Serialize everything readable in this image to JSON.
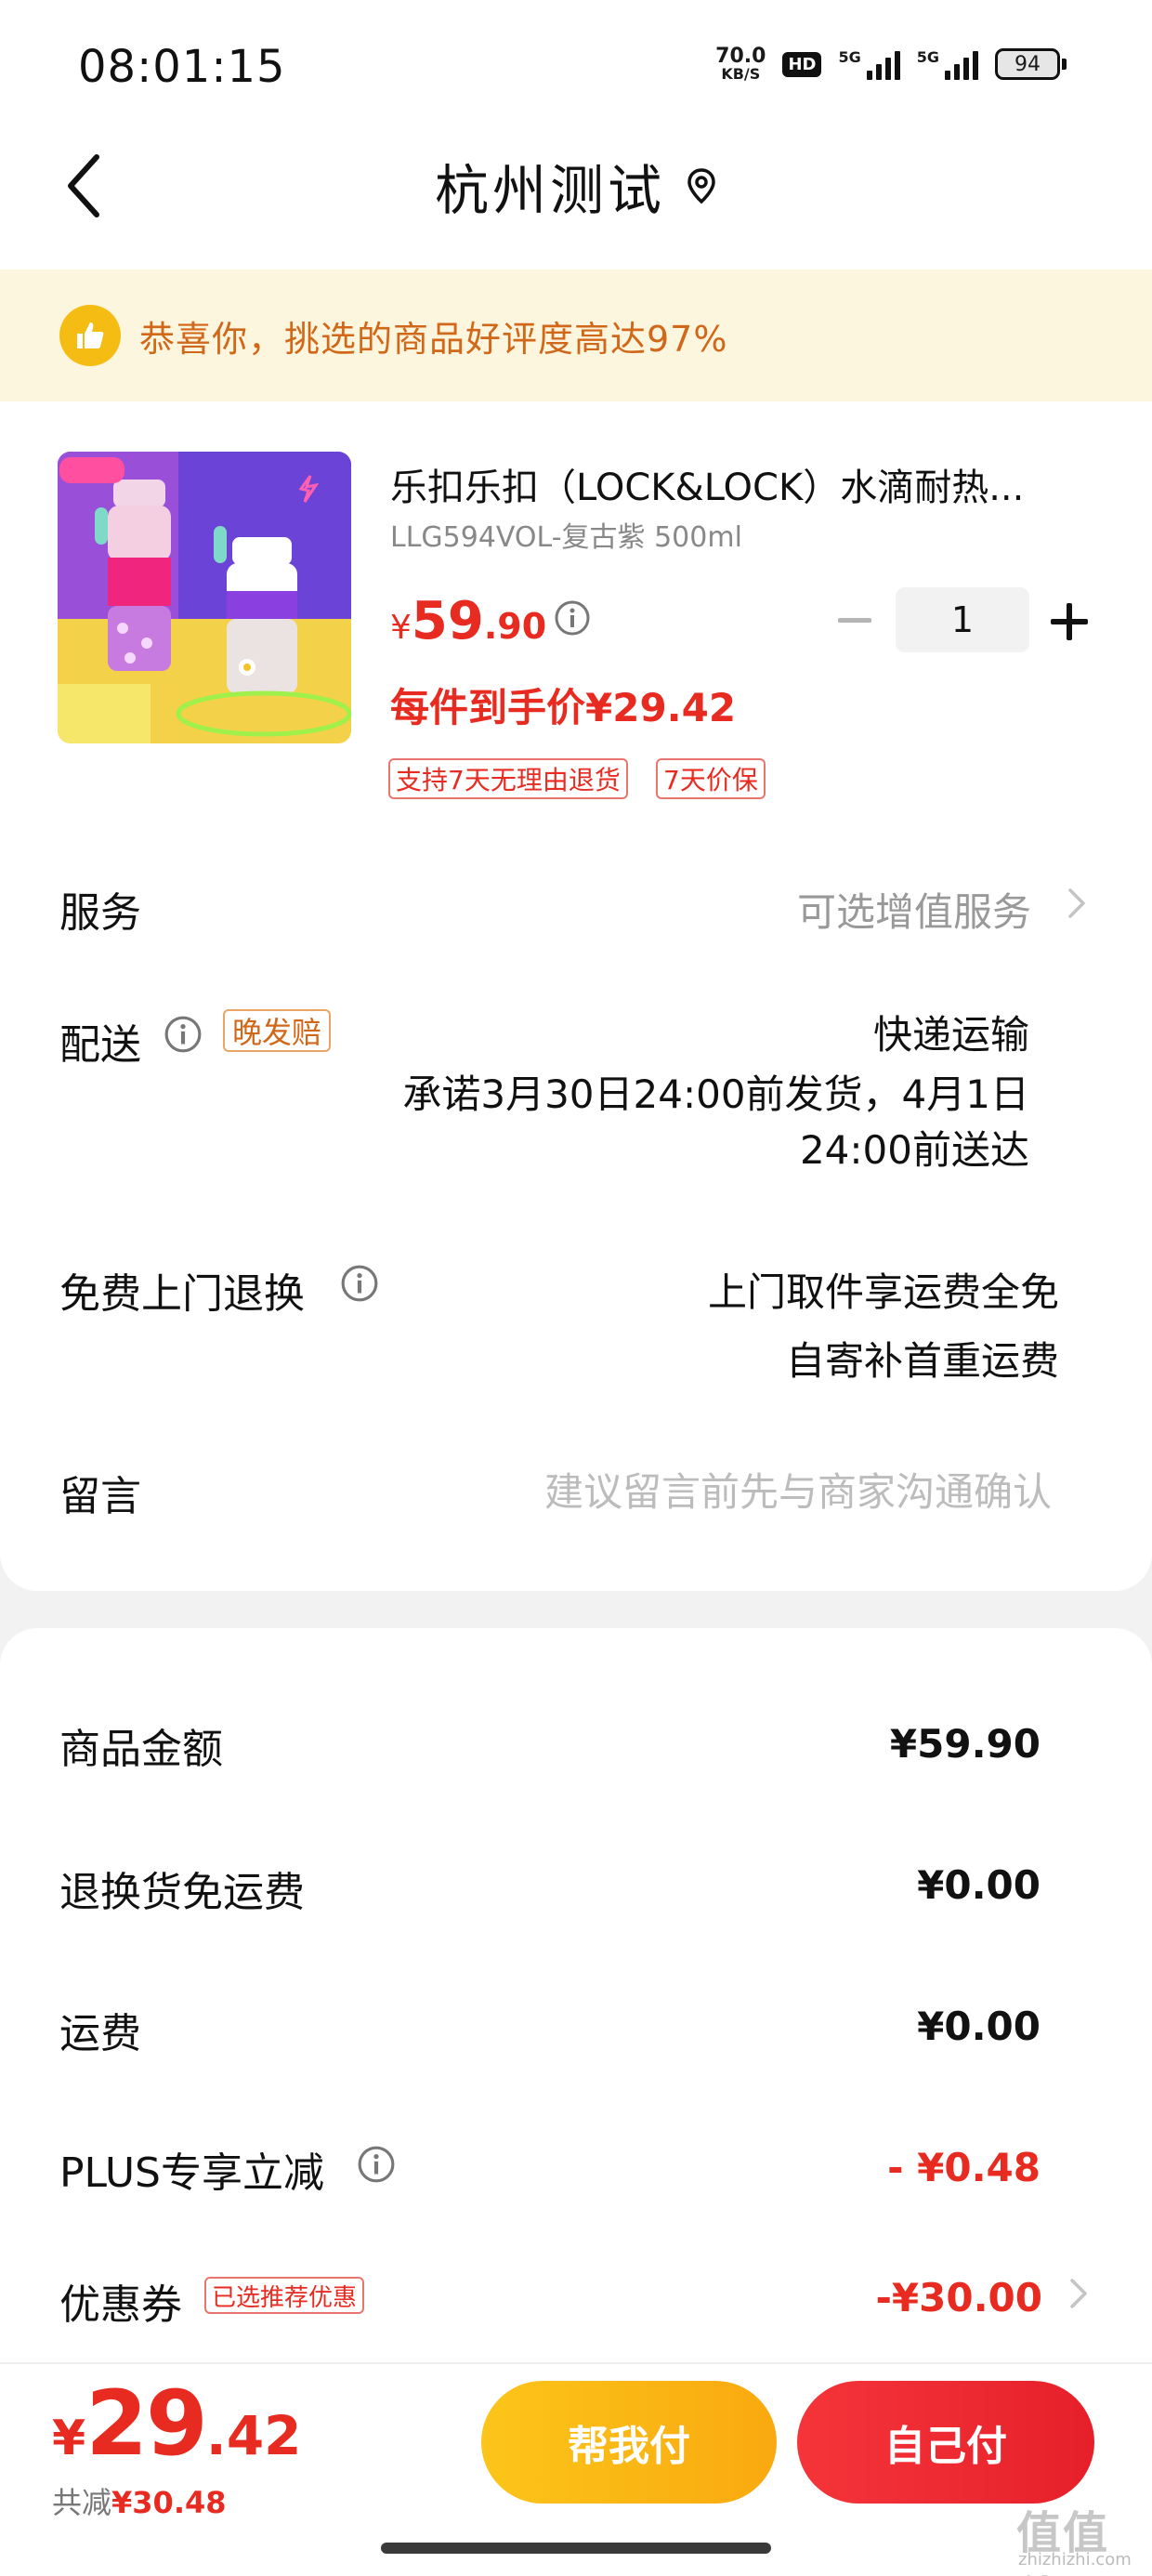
{
  "status_bar": {
    "time": "08:01:15",
    "net_speed_value": "70.0",
    "net_speed_unit": "KB/S",
    "hd_label": "HD",
    "sim1_label": "5G",
    "sim2_label": "5G",
    "battery": "94"
  },
  "nav": {
    "title": "杭州测试"
  },
  "banner": {
    "text": "恭喜你，挑选的商品好评度高达97%"
  },
  "product": {
    "title": "乐扣乐扣（LOCK&LOCK）水滴耐热...",
    "spec": "LLG594VOL-复古紫 500ml",
    "price_currency": "¥",
    "price_int": "59",
    "price_dec": ".90",
    "quantity": "1",
    "unit_price": "每件到手价¥29.42",
    "tags": [
      "支持7天无理由退货",
      "7天价保"
    ]
  },
  "service": {
    "label": "服务",
    "value": "可选增值服务"
  },
  "delivery": {
    "label": "配送",
    "badge": "晚发赔",
    "mode": "快递运输",
    "promise": "承诺3月30日24:00前发货，4月1日24:00前送达"
  },
  "free_return": {
    "label": "免费上门退换",
    "line1": "上门取件享运费全免",
    "line2": "自寄补首重运费"
  },
  "message": {
    "label": "留言",
    "placeholder": "建议留言前先与商家沟通确认"
  },
  "summary": {
    "goods_label": "商品金额",
    "goods_value": "¥59.90",
    "return_ship_label": "退换货免运费",
    "return_ship_value": "¥0.00",
    "shipping_label": "运费",
    "shipping_value": "¥0.00",
    "plus_label": "PLUS专享立减",
    "plus_value": "- ¥0.48",
    "coupon_label": "优惠券",
    "coupon_badge": "已选推荐优惠",
    "coupon_value": "-¥30.00"
  },
  "bottom": {
    "total_currency": "¥",
    "total_int": "29",
    "total_dec": ".42",
    "saved_prefix": "共减",
    "saved_amount": "¥30.48",
    "friend_pay": "帮我付",
    "self_pay": "自己付"
  },
  "watermark": {
    "text": "值值值",
    "url": "zhizhizhi.com"
  },
  "colors": {
    "accent_red": "#e82b21",
    "banner_bg": "#fdf6df",
    "banner_text": "#d16718",
    "friend_pay_bg": "#fcc51a",
    "self_pay_bg": "#f5343a"
  }
}
